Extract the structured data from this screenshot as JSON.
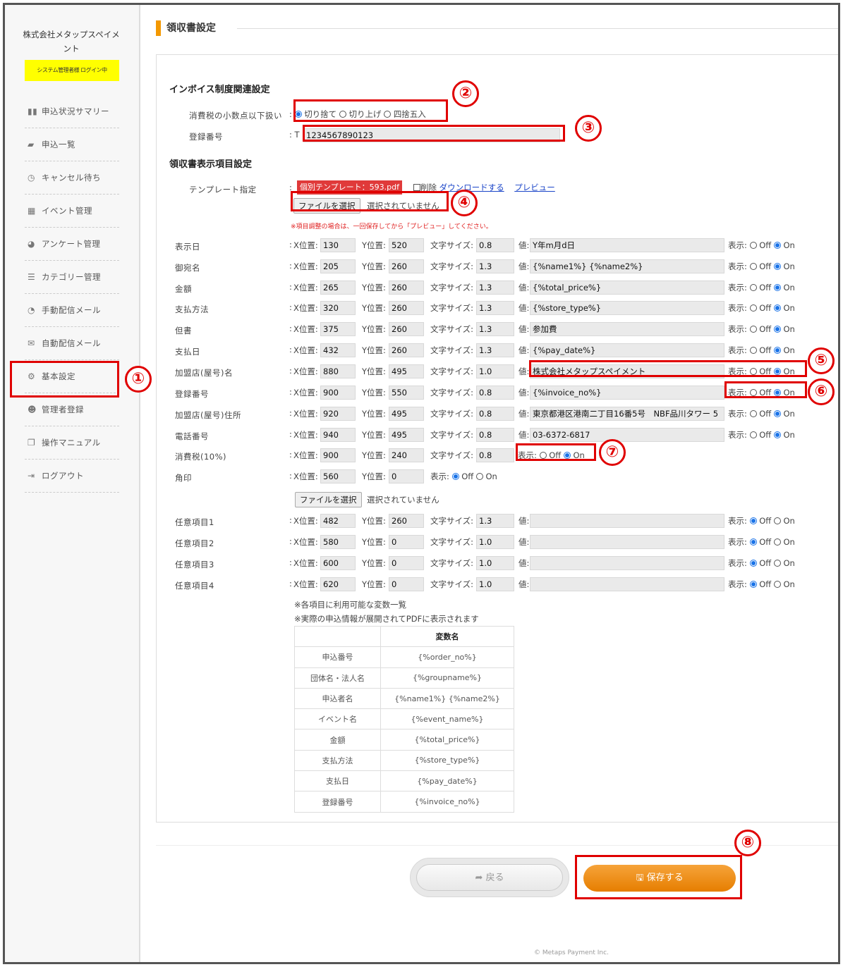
{
  "sidebar": {
    "company": "株式会社メタップスペイメント",
    "badge": "システム管理者様 ログイン中",
    "items": [
      {
        "label": "申込状況サマリー",
        "icon": "bar-chart-icon"
      },
      {
        "label": "申込一覧",
        "icon": "book-icon"
      },
      {
        "label": "キャンセル待ち",
        "icon": "clock-icon"
      },
      {
        "label": "イベント管理",
        "icon": "grid-icon"
      },
      {
        "label": "アンケート管理",
        "icon": "pie-chart-icon"
      },
      {
        "label": "カテゴリー管理",
        "icon": "list-icon"
      },
      {
        "label": "手動配信メール",
        "icon": "rss-icon"
      },
      {
        "label": "自動配信メール",
        "icon": "envelope-icon"
      },
      {
        "label": "基本設定",
        "icon": "gears-icon"
      },
      {
        "label": "管理者登録",
        "icon": "users-icon"
      },
      {
        "label": "操作マニュアル",
        "icon": "copy-icon"
      },
      {
        "label": "ログアウト",
        "icon": "sign-out-icon"
      }
    ]
  },
  "page": {
    "title": "領収書設定"
  },
  "invoice": {
    "heading": "インボイス制度関連設定",
    "rounding_label": "消費税の小数点以下扱い",
    "rounding_options": [
      "切り捨て",
      "切り上げ",
      "四捨五入"
    ],
    "rounding_selected": "切り捨て",
    "regno_label": "登録番号",
    "regno_prefix": ": T",
    "regno_value": "1234567890123"
  },
  "receipt": {
    "heading": "領収書表示項目設定",
    "template_label": "テンプレート指定",
    "template_file": "個別テンプレート：593.pdf",
    "delete_label": "削除",
    "download_link": "ダウンロードする",
    "preview_link": "プレビュー",
    "file_button": "ファイルを選択",
    "file_status": "選択されていません",
    "warning": "※項目調整の場合は、一回保存してから「プレビュー」してください。"
  },
  "fields_labels": {
    "colon": ":",
    "x": "X位置:",
    "y": "Y位置:",
    "size": "文字サイズ:",
    "value": "値:",
    "show": "表示:",
    "off": "Off",
    "on": "On"
  },
  "fields": [
    {
      "label": "表示日",
      "x": "130",
      "y": "520",
      "size": "0.8",
      "value": "Y年m月d日",
      "show": "On"
    },
    {
      "label": "御宛名",
      "x": "205",
      "y": "260",
      "size": "1.3",
      "value": "{%name1%} {%name2%}",
      "show": "On"
    },
    {
      "label": "金額",
      "x": "265",
      "y": "260",
      "size": "1.3",
      "value": "{%total_price%}",
      "show": "On"
    },
    {
      "label": "支払方法",
      "x": "320",
      "y": "260",
      "size": "1.3",
      "value": "{%store_type%}",
      "show": "On"
    },
    {
      "label": "但書",
      "x": "375",
      "y": "260",
      "size": "1.3",
      "value": "参加費",
      "show": "On"
    },
    {
      "label": "支払日",
      "x": "432",
      "y": "260",
      "size": "1.3",
      "value": "{%pay_date%}",
      "show": "On"
    },
    {
      "label": "加盟店(屋号)名",
      "x": "880",
      "y": "495",
      "size": "1.0",
      "value": "株式会社メタップスペイメント",
      "show": "On"
    },
    {
      "label": "登録番号",
      "x": "900",
      "y": "550",
      "size": "0.8",
      "value": "{%invoice_no%}",
      "show": "On"
    },
    {
      "label": "加盟店(屋号)住所",
      "x": "920",
      "y": "495",
      "size": "0.8",
      "value": "東京都港区港南二丁目16番5号　NBF品川タワー 5",
      "show": "On"
    },
    {
      "label": "電話番号",
      "x": "940",
      "y": "495",
      "size": "0.8",
      "value": "03-6372-6817",
      "show": "On"
    },
    {
      "label": "消費税(10%)",
      "x": "900",
      "y": "240",
      "size": "0.8",
      "show": "On"
    },
    {
      "label": "角印",
      "x": "560",
      "y": "0",
      "show": "Off"
    }
  ],
  "stamp_file": {
    "button": "ファイルを選択",
    "status": "選択されていません"
  },
  "optional": [
    {
      "label": "任意項目1",
      "x": "482",
      "y": "260",
      "size": "1.3",
      "value": "",
      "show": "Off"
    },
    {
      "label": "任意項目2",
      "x": "580",
      "y": "0",
      "size": "1.0",
      "value": "",
      "show": "Off"
    },
    {
      "label": "任意項目3",
      "x": "600",
      "y": "0",
      "size": "1.0",
      "value": "",
      "show": "Off"
    },
    {
      "label": "任意項目4",
      "x": "620",
      "y": "0",
      "size": "1.0",
      "value": "",
      "show": "Off"
    }
  ],
  "vars": {
    "note1": "※各項目に利用可能な変数一覧",
    "note2": "※実際の申込情報が展開されてPDFに表示されます",
    "header": "変数名",
    "rows": [
      [
        "申込番号",
        "{%order_no%}"
      ],
      [
        "団体名・法人名",
        "{%groupname%}"
      ],
      [
        "申込者名",
        "{%name1%} {%name2%}"
      ],
      [
        "イベント名",
        "{%event_name%}"
      ],
      [
        "金額",
        "{%total_price%}"
      ],
      [
        "支払方法",
        "{%store_type%}"
      ],
      [
        "支払日",
        "{%pay_date%}"
      ],
      [
        "登録番号",
        "{%invoice_no%}"
      ]
    ]
  },
  "actions": {
    "back": "戻る",
    "save": "保存する"
  },
  "footer": "© Metaps Payment Inc.",
  "callouts": [
    "①",
    "②",
    "③",
    "④",
    "⑤",
    "⑥",
    "⑦",
    "⑧"
  ],
  "colors": {
    "accent": "#f39800",
    "highlight": "#e00000",
    "badge": "#ffff00",
    "radio": "#1a73e8"
  }
}
